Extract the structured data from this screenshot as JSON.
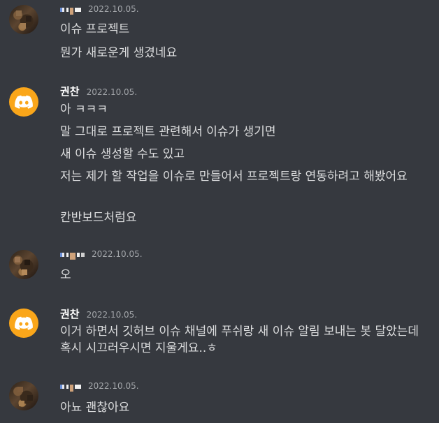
{
  "messages": [
    {
      "author": "",
      "author_pixelated": true,
      "avatar": "user-photo",
      "timestamp": "2022.10.05.",
      "lines": [
        "이슈 프로젝트",
        "뭔가 새로운게 생겼네요"
      ]
    },
    {
      "author": "권찬",
      "author_pixelated": false,
      "avatar": "discord-logo",
      "timestamp": "2022.10.05.",
      "lines": [
        "아 ㅋㅋㅋ",
        "말 그대로 프로젝트 관련해서 이슈가 생기면",
        "새 이슈 생성할 수도 있고",
        "저는 제가 할 작업을 이슈로 만들어서 프로젝트랑 연동하려고 해봤어요",
        "칸반보드처럼요"
      ]
    },
    {
      "author": "",
      "author_pixelated": true,
      "avatar": "user-photo",
      "timestamp": "2022.10.05.",
      "lines": [
        "오"
      ]
    },
    {
      "author": "권찬",
      "author_pixelated": false,
      "avatar": "discord-logo",
      "timestamp": "2022.10.05.",
      "lines": [
        "이거 하면서 깃허브 이슈 채널에 푸쉬랑 새 이슈 알림 보내는 봇 달았는데 혹시 시끄러우시면 지울게요..ㅎ"
      ]
    },
    {
      "author": "",
      "author_pixelated": true,
      "avatar": "user-photo",
      "timestamp": "2022.10.05.",
      "lines": [
        "아뇨 괜찮아요"
      ]
    }
  ],
  "colors": {
    "background": "#36393f",
    "text": "#dcddde",
    "timestamp": "#a3a6aa",
    "discord_avatar": "#faa61a"
  }
}
